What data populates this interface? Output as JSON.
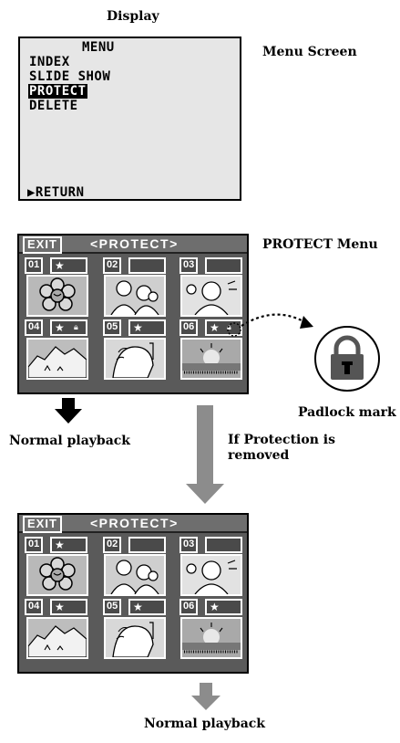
{
  "labels": {
    "display": "Display",
    "menu_screen": "Menu Screen",
    "protect_menu": "PROTECT Menu",
    "padlock_mark": "Padlock mark",
    "normal_playback_left": "Normal playback",
    "if_protection_line1": "If Protection is",
    "if_protection_line2": "removed",
    "normal_playback_bottom": "Normal playback"
  },
  "menu": {
    "title": "MENU",
    "items": [
      "INDEX",
      "SLIDE SHOW",
      "PROTECT",
      "DELETE"
    ],
    "return_label": "▶RETURN"
  },
  "protect_screen_1": {
    "exit": "EXIT",
    "title": "<PROTECT>",
    "cells": [
      {
        "num": "01",
        "star": "★"
      },
      {
        "num": "02"
      },
      {
        "num": "03"
      },
      {
        "num": "04",
        "star": "★"
      },
      {
        "num": "05",
        "star": "★"
      },
      {
        "num": "06",
        "star": "★"
      }
    ]
  },
  "protect_screen_2": {
    "exit": "EXIT",
    "title": "<PROTECT>",
    "cells": [
      {
        "num": "01",
        "star": "★"
      },
      {
        "num": "02"
      },
      {
        "num": "03"
      },
      {
        "num": "04",
        "star": "★"
      },
      {
        "num": "05",
        "star": "★"
      },
      {
        "num": "06",
        "star": "★"
      }
    ]
  },
  "colors": {
    "screen_bg": "#5a5a5a",
    "thumb_bg": "#b9b9b9",
    "arrow_gray": "#8c8c8c",
    "arrow_black": "#000000"
  }
}
